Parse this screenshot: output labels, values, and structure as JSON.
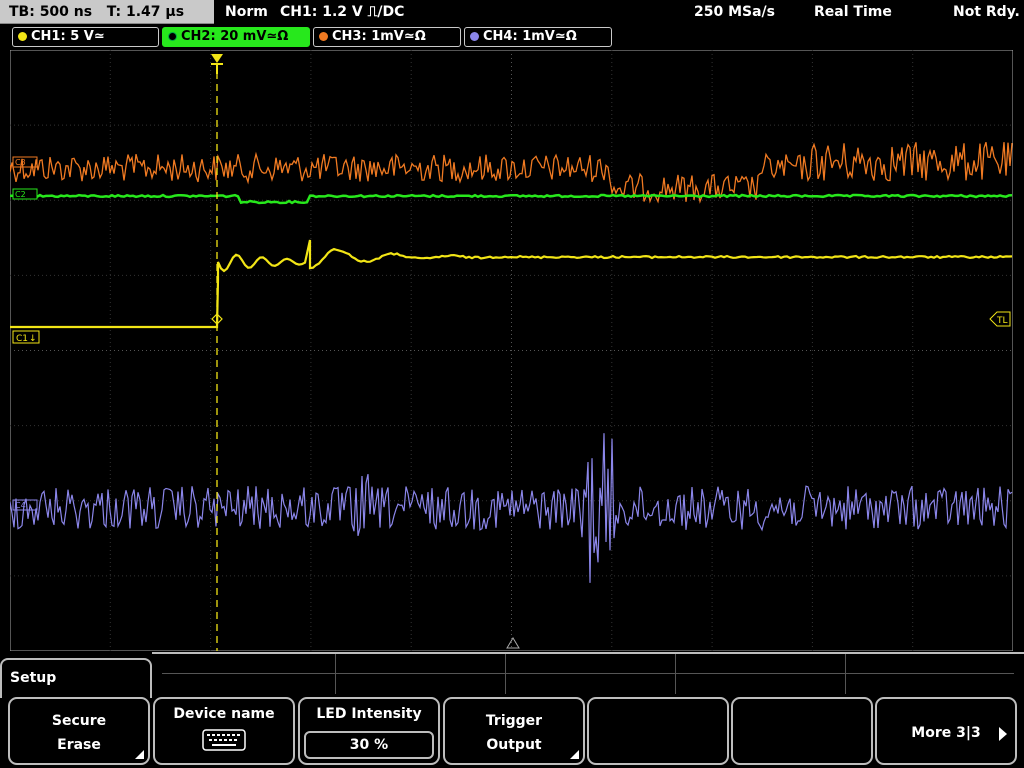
{
  "status": {
    "timebase": "TB: 500 ns",
    "trigger_time": "T: 1.47 µs",
    "mode": "Norm",
    "trigger_info": "CH1: 1.2 V ⎍/DC",
    "sample_rate": "250 MSa/s",
    "acq_mode": "Real Time",
    "state": "Not Rdy."
  },
  "channels": [
    {
      "label": "CH1: 5 V≃",
      "color": "#f2e516"
    },
    {
      "label": "CH2: 20 mV≃Ω",
      "color": "#27e81c"
    },
    {
      "label": "CH3: 1mV≃Ω",
      "color": "#f07a22"
    },
    {
      "label": "CH4: 1mV≃Ω",
      "color": "#8b86ea"
    }
  ],
  "screen_markers": {
    "ch1_ref": "C1",
    "trigger_level": "TL",
    "ch2_ref": "C2",
    "ch3_ref": "C3",
    "ch4_ref": "C4"
  },
  "menu": {
    "title": "Setup",
    "softkeys": [
      {
        "line1": "Secure",
        "line2": "Erase"
      },
      {
        "line1": "Device name",
        "icon": "keyboard-icon"
      },
      {
        "line1": "LED Intensity",
        "value": "30 %"
      },
      {
        "line1": "Trigger",
        "line2": "Output"
      },
      {
        "line1": ""
      },
      {
        "line1": ""
      },
      {
        "line1": "More 3|3"
      }
    ]
  }
}
